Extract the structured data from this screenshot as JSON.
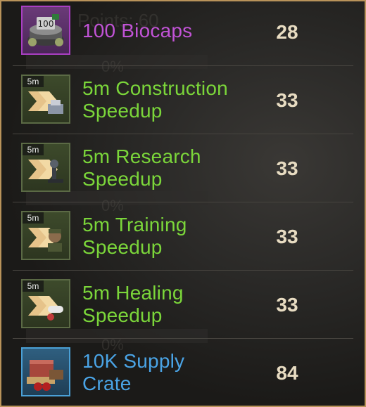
{
  "rewards": [
    {
      "name_line1": "100 Biocaps",
      "name_line2": "",
      "points": "28",
      "badge": "",
      "icon": "biocaps-icon",
      "rarity_color": "#c153d6"
    },
    {
      "name_line1": "5m Construction",
      "name_line2": "Speedup",
      "points": "33",
      "badge": "5m",
      "icon": "construction-speedup-icon",
      "rarity_color": "#7bd63a"
    },
    {
      "name_line1": "5m Research",
      "name_line2": "Speedup",
      "points": "33",
      "badge": "5m",
      "icon": "research-speedup-icon",
      "rarity_color": "#7bd63a"
    },
    {
      "name_line1": "5m Training",
      "name_line2": "Speedup",
      "points": "33",
      "badge": "5m",
      "icon": "training-speedup-icon",
      "rarity_color": "#7bd63a"
    },
    {
      "name_line1": "5m Healing",
      "name_line2": "Speedup",
      "points": "33",
      "badge": "5m",
      "icon": "healing-speedup-icon",
      "rarity_color": "#7bd63a"
    },
    {
      "name_line1": "10K Supply",
      "name_line2": "Crate",
      "points": "84",
      "badge": "",
      "icon": "supply-crate-icon",
      "rarity_color": "#4aa4e6"
    }
  ],
  "background": {
    "points_label": "Points: 60",
    "percent": "0%"
  },
  "colors": {
    "frame": "#b9935a",
    "divider": "#47443f",
    "points": "#e8dcc2"
  }
}
